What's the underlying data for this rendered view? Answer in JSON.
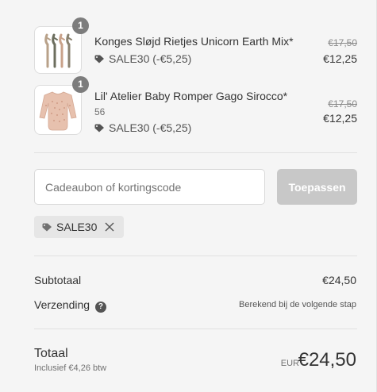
{
  "items": [
    {
      "name": "Konges Sløjd Rietjes Unicorn Earth Mix*",
      "quantity": "1",
      "variant": "",
      "discount": "SALE30 (-€5,25)",
      "old_price": "€17,50",
      "price": "€12,25"
    },
    {
      "name": "Lil' Atelier Baby Romper Gago Sirocco*",
      "quantity": "1",
      "variant": "56",
      "discount": "SALE30 (-€5,25)",
      "old_price": "€17,50",
      "price": "€12,25"
    }
  ],
  "discount_form": {
    "placeholder": "Cadeaubon of kortingscode",
    "apply_label": "Toepassen",
    "applied_code": "SALE30"
  },
  "summary": {
    "subtotal_label": "Subtotaal",
    "subtotal_value": "€24,50",
    "shipping_label": "Verzending",
    "shipping_note": "Berekend bij de volgende stap",
    "total_label": "Totaal",
    "tax_note": "Inclusief €4,26 btw",
    "currency": "EUR",
    "total_value": "€24,50"
  },
  "colors": {
    "background": "#f5f5f5",
    "button_disabled": "#c8c8c8",
    "badge": "#727272"
  },
  "icons": {
    "tag": "tag-icon",
    "close": "close-icon",
    "help": "help-icon"
  }
}
